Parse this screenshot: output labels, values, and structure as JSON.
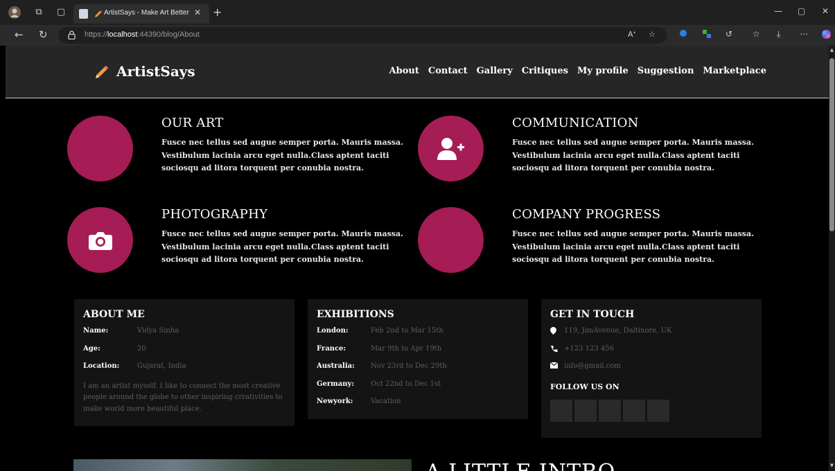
{
  "browser": {
    "tab_title": "ArtistSays - Make Art Better",
    "url_scheme": "https://",
    "url_host": "localhost",
    "url_rest": ":44390/blog/About",
    "icons": {
      "back": "arrow-left-icon",
      "refresh": "refresh-icon",
      "lock": "lock-icon",
      "read_aloud": "read-aloud-icon",
      "favorite": "star-icon",
      "downloads": "download-icon",
      "more": "more-icon"
    }
  },
  "site": {
    "logo_text": "ArtistSays",
    "nav": [
      "About",
      "Contact",
      "Gallery",
      "Critiques",
      "My profile",
      "Suggestion",
      "Marketplace"
    ],
    "accent_color": "#a61c55"
  },
  "features": [
    {
      "title": "OUR ART",
      "text": "Fusce nec tellus sed augue semper porta. Mauris massa. Vestibulum lacinia arcu eget nulla.Class aptent taciti sociosqu ad litora torquent per conubia nostra.",
      "icon": ""
    },
    {
      "title": "COMMUNICATION",
      "text": "Fusce nec tellus sed augue semper porta. Mauris massa. Vestibulum lacinia arcu eget nulla.Class aptent taciti sociosqu ad litora torquent per conubia nostra.",
      "icon": "user-plus-icon"
    },
    {
      "title": "PHOTOGRAPHY",
      "text": "Fusce nec tellus sed augue semper porta. Mauris massa. Vestibulum lacinia arcu eget nulla.Class aptent taciti sociosqu ad litora torquent per conubia nostra.",
      "icon": "camera-icon"
    },
    {
      "title": "COMPANY PROGRESS",
      "text": "Fusce nec tellus sed augue semper porta. Mauris massa. Vestibulum lacinia arcu eget nulla.Class aptent taciti sociosqu ad litora torquent per conubia nostra.",
      "icon": ""
    }
  ],
  "about": {
    "title": "ABOUT ME",
    "rows": [
      {
        "k": "Name:",
        "v": "Vidya Sinha"
      },
      {
        "k": "Age:",
        "v": "20"
      },
      {
        "k": "Location:",
        "v": "Gujarat, India"
      }
    ],
    "desc": "I am an artist myself. I like to connect the most creative people around the globe to other inspiring crrativities to make world more beautiful place."
  },
  "exhibitions": {
    "title": "EXHIBITIONS",
    "rows": [
      {
        "k": "London:",
        "v": "Feb 2nd to Mar 15th"
      },
      {
        "k": "France:",
        "v": "Mar 9th to Apr 19th"
      },
      {
        "k": "Australia:",
        "v": "Nov 23rd to Dec 29th"
      },
      {
        "k": "Germany:",
        "v": "Oct 22nd to Dec 1st"
      },
      {
        "k": "Newyork:",
        "v": "Vacation"
      }
    ]
  },
  "contact": {
    "title": "GET IN TOUCH",
    "address": "119, JimAvenue, Daltinore, UK",
    "phone": "+123 123 456",
    "email": "info@gmail.com",
    "follow": "FOLLOW US ON"
  },
  "intro": {
    "title": "A LITTLE INTRO"
  }
}
